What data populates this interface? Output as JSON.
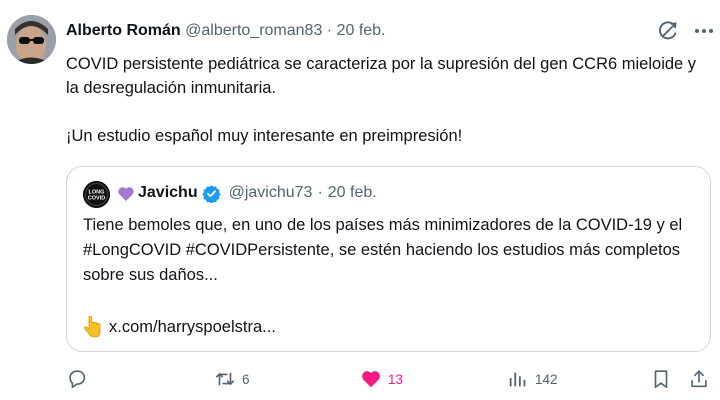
{
  "tweet": {
    "author_name": "Alberto Román",
    "author_handle": "@alberto_roman83",
    "separator": "·",
    "date": "20 feb.",
    "text_line1": "COVID persistente pediátrica se caracteriza por la supresión del gen CCR6 mieloide y la desregulación inmunitaria.",
    "text_line2": "¡Un estudio español muy interesante en preimpresión!"
  },
  "quote": {
    "author_name": "Javichu",
    "author_handle": "@javichu73",
    "separator": "·",
    "date": "20 feb.",
    "avatar_text_top": "LONG",
    "avatar_text_bottom": "COVID",
    "text": "Tiene bemoles que, en uno de los países más minimizadores de la COVID-19 y el #LongCOVID #COVIDPersistente, se estén haciendo los estudios más completos sobre sus daños...",
    "link": "x.com/harryspoelstra..."
  },
  "actions": {
    "reply_count": "",
    "repost_count": "6",
    "like_count": "13",
    "views_count": "142"
  },
  "colors": {
    "like": "#f91880",
    "verified": "#1d9bf0",
    "purple_heart": "#a477d4",
    "muted": "#536471"
  },
  "icons": [
    "grok-icon",
    "more-icon",
    "verified-icon",
    "purple-heart-icon",
    "pointing-down-icon",
    "reply-icon",
    "repost-icon",
    "like-icon",
    "views-icon",
    "bookmark-icon",
    "share-icon"
  ]
}
